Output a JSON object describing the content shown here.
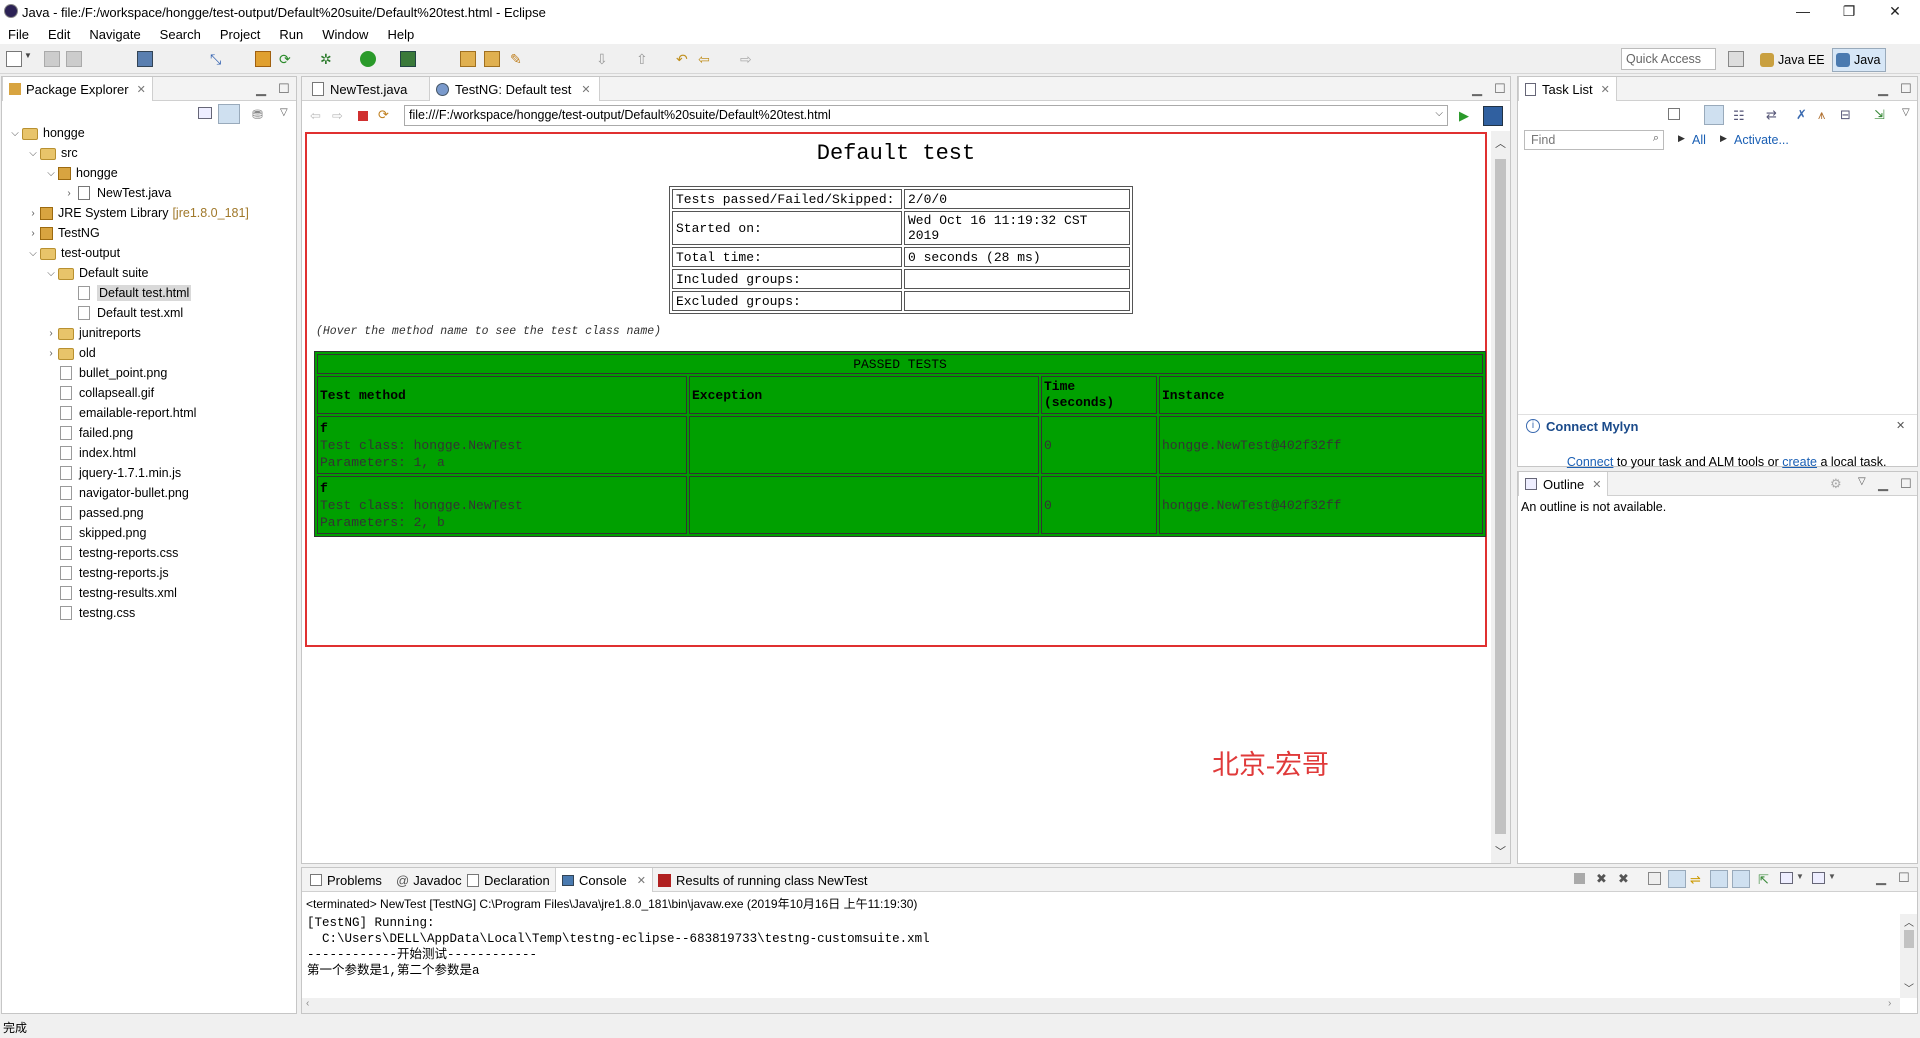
{
  "window": {
    "title": "Java - file:/F:/workspace/hongge/test-output/Default%20suite/Default%20test.html - Eclipse",
    "controls": [
      "—",
      "❐",
      "✕"
    ]
  },
  "menu": [
    "File",
    "Edit",
    "Navigate",
    "Search",
    "Project",
    "Run",
    "Window",
    "Help"
  ],
  "toolbar": {
    "quick_access_placeholder": "Quick Access",
    "perspectives": [
      "Java EE",
      "Java"
    ]
  },
  "package_explorer": {
    "title": "Package Explorer",
    "tree": [
      {
        "label": "hongge",
        "level": 0,
        "arrow": "down",
        "icon": "project"
      },
      {
        "label": "src",
        "level": 1,
        "arrow": "down",
        "icon": "folder"
      },
      {
        "label": "hongge",
        "level": 2,
        "arrow": "down",
        "icon": "package"
      },
      {
        "label": "NewTest.java",
        "level": 3,
        "arrow": "right",
        "icon": "java"
      },
      {
        "label": "JRE System Library",
        "suffix": "[jre1.8.0_181]",
        "level": 1,
        "arrow": "right",
        "icon": "library"
      },
      {
        "label": "TestNG",
        "level": 1,
        "arrow": "right",
        "icon": "library"
      },
      {
        "label": "test-output",
        "level": 1,
        "arrow": "down",
        "icon": "folder"
      },
      {
        "label": "Default suite",
        "level": 2,
        "arrow": "down",
        "icon": "folder"
      },
      {
        "label": "Default test.html",
        "level": 3,
        "arrow": "",
        "icon": "file",
        "selected": true
      },
      {
        "label": "Default test.xml",
        "level": 3,
        "arrow": "",
        "icon": "file"
      },
      {
        "label": "junitreports",
        "level": 2,
        "arrow": "right",
        "icon": "folder"
      },
      {
        "label": "old",
        "level": 2,
        "arrow": "right",
        "icon": "folder"
      },
      {
        "label": "bullet_point.png",
        "level": 2,
        "arrow": "",
        "icon": "file"
      },
      {
        "label": "collapseall.gif",
        "level": 2,
        "arrow": "",
        "icon": "file"
      },
      {
        "label": "emailable-report.html",
        "level": 2,
        "arrow": "",
        "icon": "file"
      },
      {
        "label": "failed.png",
        "level": 2,
        "arrow": "",
        "icon": "file"
      },
      {
        "label": "index.html",
        "level": 2,
        "arrow": "",
        "icon": "file"
      },
      {
        "label": "jquery-1.7.1.min.js",
        "level": 2,
        "arrow": "",
        "icon": "file"
      },
      {
        "label": "navigator-bullet.png",
        "level": 2,
        "arrow": "",
        "icon": "file"
      },
      {
        "label": "passed.png",
        "level": 2,
        "arrow": "",
        "icon": "file"
      },
      {
        "label": "skipped.png",
        "level": 2,
        "arrow": "",
        "icon": "file"
      },
      {
        "label": "testng-reports.css",
        "level": 2,
        "arrow": "",
        "icon": "file"
      },
      {
        "label": "testng-reports.js",
        "level": 2,
        "arrow": "",
        "icon": "file"
      },
      {
        "label": "testng-results.xml",
        "level": 2,
        "arrow": "",
        "icon": "file"
      },
      {
        "label": "testng.css",
        "level": 2,
        "arrow": "",
        "icon": "file"
      }
    ]
  },
  "editor": {
    "tabs": [
      {
        "label": "NewTest.java",
        "active": false
      },
      {
        "label": "TestNG: Default test",
        "active": true
      }
    ],
    "url": "file:///F:/workspace/hongge/test-output/Default%20suite/Default%20test.html",
    "report": {
      "title": "Default test",
      "info": [
        {
          "label": "Tests passed/Failed/Skipped:",
          "value": "2/0/0"
        },
        {
          "label": "Started on:",
          "value": "Wed Oct 16 11:19:32 CST 2019"
        },
        {
          "label": "Total time:",
          "value": "0 seconds (28 ms)"
        },
        {
          "label": "Included groups:",
          "value": ""
        },
        {
          "label": "Excluded groups:",
          "value": ""
        }
      ],
      "hint": "(Hover the method name to see the test class name)",
      "passed_header": "PASSED TESTS",
      "columns": [
        "Test method",
        "Exception",
        "Time\n(seconds)",
        "Instance"
      ],
      "rows": [
        {
          "method": "f",
          "class_line": "Test class: hongge.NewTest",
          "params_line": "Parameters: 1, a",
          "exception": "",
          "time": "0",
          "instance": "hongge.NewTest@402f32ff"
        },
        {
          "method": "f",
          "class_line": "Test class: hongge.NewTest",
          "params_line": "Parameters: 2, b",
          "exception": "",
          "time": "0",
          "instance": "hongge.NewTest@402f32ff"
        }
      ]
    },
    "watermark": "北京-宏哥"
  },
  "task_list": {
    "title": "Task List",
    "find_placeholder": "Find",
    "all_label": "All",
    "activate_label": "Activate...",
    "mylyn_title": "Connect Mylyn",
    "mylyn_connect": "Connect",
    "mylyn_text_1": " to your task and ALM tools or ",
    "mylyn_create": "create",
    "mylyn_text_2": " a local task."
  },
  "outline": {
    "title": "Outline",
    "empty_text": "An outline is not available."
  },
  "bottom": {
    "tabs": [
      {
        "label": "Problems",
        "active": false
      },
      {
        "label": "Javadoc",
        "active": false
      },
      {
        "label": "Declaration",
        "active": false
      },
      {
        "label": "Console",
        "active": true
      },
      {
        "label": "Results of running class NewTest",
        "active": false
      }
    ],
    "console_header": "<terminated> NewTest [TestNG] C:\\Program Files\\Java\\jre1.8.0_181\\bin\\javaw.exe (2019年10月16日 上午11:19:30)",
    "console_lines": [
      "[TestNG] Running:",
      "  C:\\Users\\DELL\\AppData\\Local\\Temp\\testng-eclipse--683819733\\testng-customsuite.xml",
      "",
      "------------开始测试------------",
      "第一个参数是1,第二个参数是a"
    ]
  },
  "status_bar": {
    "text": "完成"
  }
}
